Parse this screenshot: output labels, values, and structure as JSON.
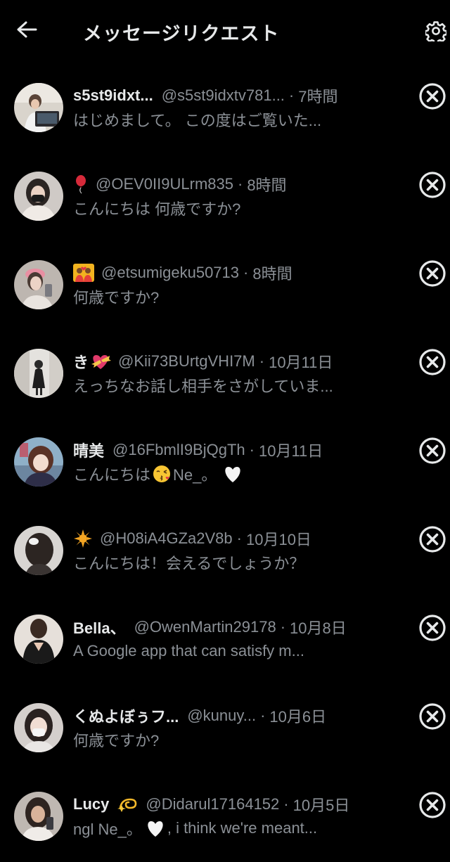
{
  "header": {
    "title": "メッセージリクエスト",
    "back_icon": "arrow-left-icon",
    "settings_icon": "gear-icon"
  },
  "colors": {
    "background": "#000000",
    "primary_text": "#e7e9ea",
    "secondary_text": "#8b9096"
  },
  "requests": [
    {
      "name": "s5st9idxt...",
      "handle": "@s5st9idxtv781...",
      "time": "7時間",
      "preview": "はじめまして。 この度はご覧いた..."
    },
    {
      "name": "",
      "name_emoji": "balloon",
      "handle": "@OEV0II9ULrm835",
      "time": "8時間",
      "preview": "こんにちは 何歳ですか?"
    },
    {
      "name": "",
      "name_emoji": "couple-heart",
      "handle": "@etsumigeku50713",
      "time": "8時間",
      "preview": "何歳ですか?"
    },
    {
      "name": "き",
      "name_emoji": "heart-ribbon",
      "handle": "@Kii73BUrtgVHI7M",
      "time": "10月11日",
      "preview": "えっちなお話し相手をさがしていま..."
    },
    {
      "name": "晴美",
      "handle": "@16FbmlI9BjQgTh",
      "time": "10月11日",
      "preview_before": "こんにちは",
      "preview_emoji": "kiss-face",
      "preview_after": " Ne_。",
      "preview_end_emoji": "white-heart"
    },
    {
      "name": "",
      "name_emoji": "sun",
      "handle": "@H08iA4GZa2V8b",
      "time": "10月10日",
      "preview": "こんにちは！会えるでしょうか？"
    },
    {
      "name": "Bella、",
      "handle": "@OwenMartin29178",
      "time": "10月8日",
      "preview": "A Google app that can satisfy m..."
    },
    {
      "name": "くぬよぼぅフ...",
      "handle": "@kunuy...",
      "time": "10月6日",
      "preview": "何歳ですか?"
    },
    {
      "name": "Lucy",
      "name_emoji": "dizzy",
      "handle": "@Didarul17164152",
      "time": "10月5日",
      "preview_before": "ngl Ne_。",
      "preview_emoji": "white-heart",
      "preview_after": ", i think we're meant..."
    }
  ]
}
